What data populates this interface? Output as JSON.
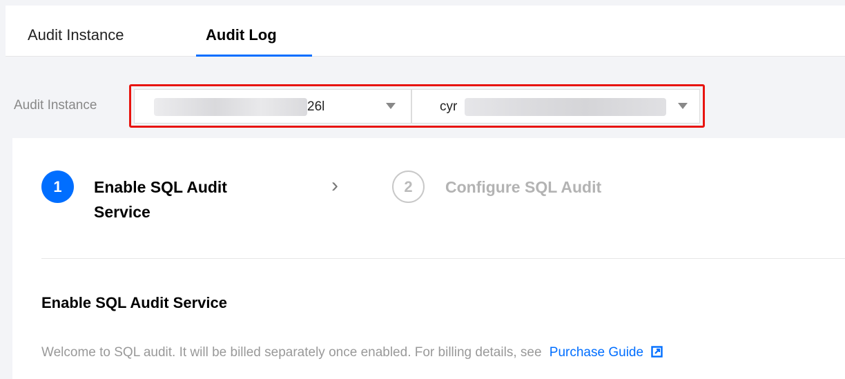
{
  "tabs": [
    {
      "label": "Audit Instance",
      "active": false
    },
    {
      "label": "Audit Log",
      "active": true
    }
  ],
  "filter": {
    "label": "Audit Instance",
    "instance_select": {
      "value_visible_suffix": "26l",
      "redacted": true
    },
    "database_select": {
      "value_visible_prefix": "cyr",
      "redacted": true
    }
  },
  "steps": [
    {
      "number": "1",
      "title": "Enable SQL Audit Service",
      "state": "active"
    },
    {
      "number": "2",
      "title": "Configure SQL Audit",
      "state": "inactive"
    }
  ],
  "section": {
    "title": "Enable SQL Audit Service",
    "description": "Welcome to SQL audit. It will be billed separately once enabled. For billing details, see",
    "link_label": "Purchase Guide"
  },
  "colors": {
    "accent": "#006eff",
    "highlight": "#e8140f",
    "inactive": "#b3b3b3"
  },
  "icons": {
    "step_separator": "chevron-right-icon",
    "select_caret": "caret-down-icon",
    "link": "external-link-icon"
  }
}
